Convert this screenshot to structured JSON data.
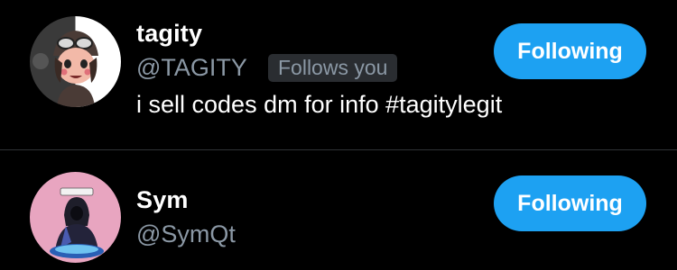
{
  "accent_color": "#1da1f2",
  "users": [
    {
      "display_name": "tagity",
      "handle": "@TAGITY",
      "follows_you_badge": "Follows you",
      "bio": "i sell codes dm for info #tagitylegit",
      "follow_button_label": "Following",
      "avatar": "cartoon-aviator-avatar"
    },
    {
      "display_name": "Sym",
      "handle": "@SymQt",
      "follow_button_label": "Following",
      "avatar": "hooded-character-avatar"
    }
  ]
}
